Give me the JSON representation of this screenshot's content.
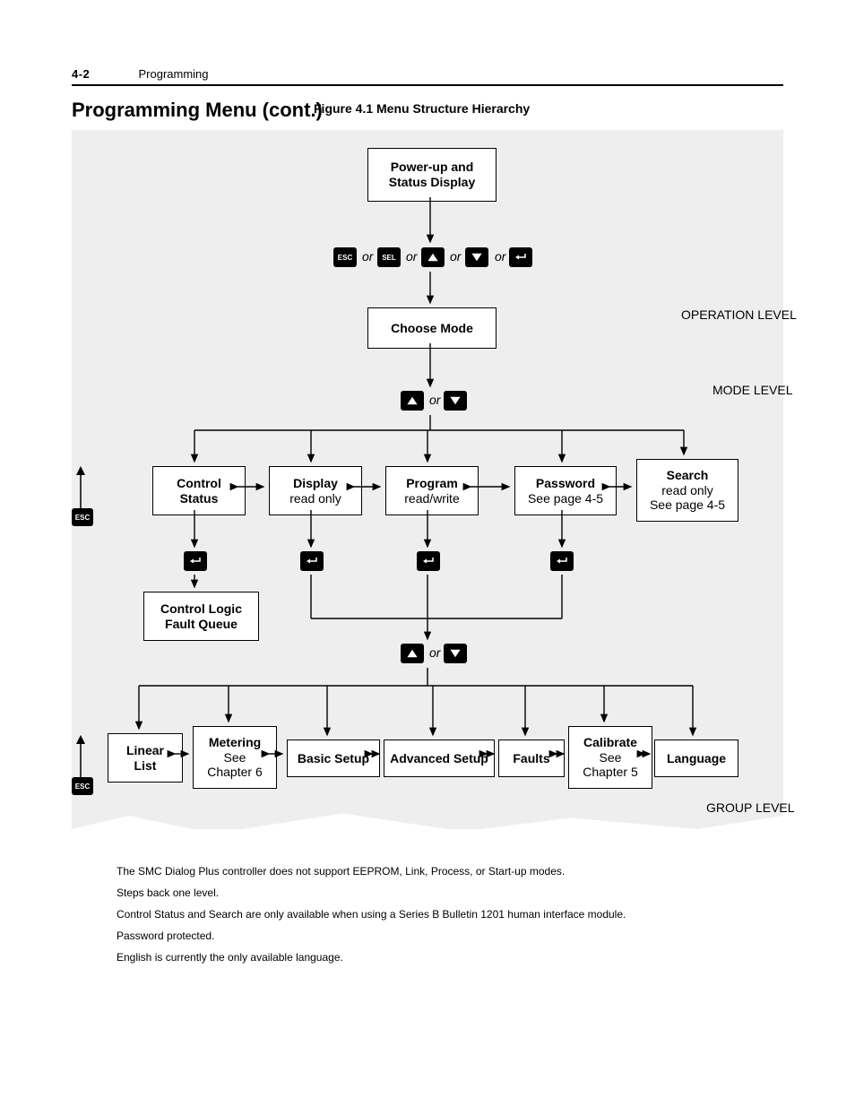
{
  "header": {
    "page": "4-2",
    "chapter": "Programming"
  },
  "section_title": "Programming Menu (cont.)",
  "figure_title": "Figure 4.1   Menu Structure Hierarchy",
  "levels": {
    "operation": "OPERATION LEVEL",
    "mode": "MODE LEVEL",
    "group": "GROUP LEVEL"
  },
  "boxes": {
    "powerup": {
      "t": "Power-up and",
      "s": "Status Display"
    },
    "choose": {
      "t": "Choose Mode"
    },
    "control_status": {
      "t": "Control",
      "s": "Status"
    },
    "display": {
      "t": "Display",
      "s": "read only"
    },
    "program": {
      "t": "Program",
      "s": "read/write"
    },
    "password": {
      "t": "Password",
      "s": "See page 4-5"
    },
    "search": {
      "t": "Search",
      "s1": "read only",
      "s2": "See page 4-5"
    },
    "clfq": {
      "t": "Control Logic",
      "s": "Fault Queue"
    },
    "linear": {
      "t": "Linear",
      "s": "List"
    },
    "metering": {
      "t": "Metering",
      "s1": "See",
      "s2": "Chapter 6"
    },
    "basic": {
      "t": "Basic Setup"
    },
    "advanced": {
      "t": "Advanced Setup"
    },
    "faults": {
      "t": "Faults"
    },
    "calibrate": {
      "t": "Calibrate",
      "s1": "See",
      "s2": "Chapter 5"
    },
    "language": {
      "t": "Language"
    }
  },
  "or": "or",
  "keys": {
    "esc": "ESC",
    "sel": "SEL"
  },
  "notes": [
    "The SMC Dialog Plus controller does not support EEPROM, Link, Process, or Start-up modes.",
    "Steps back one level.",
    "Control Status and Search are only available when using a Series B Bulletin 1201 human interface module.",
    "Password protected.",
    "English is currently the only available language."
  ]
}
